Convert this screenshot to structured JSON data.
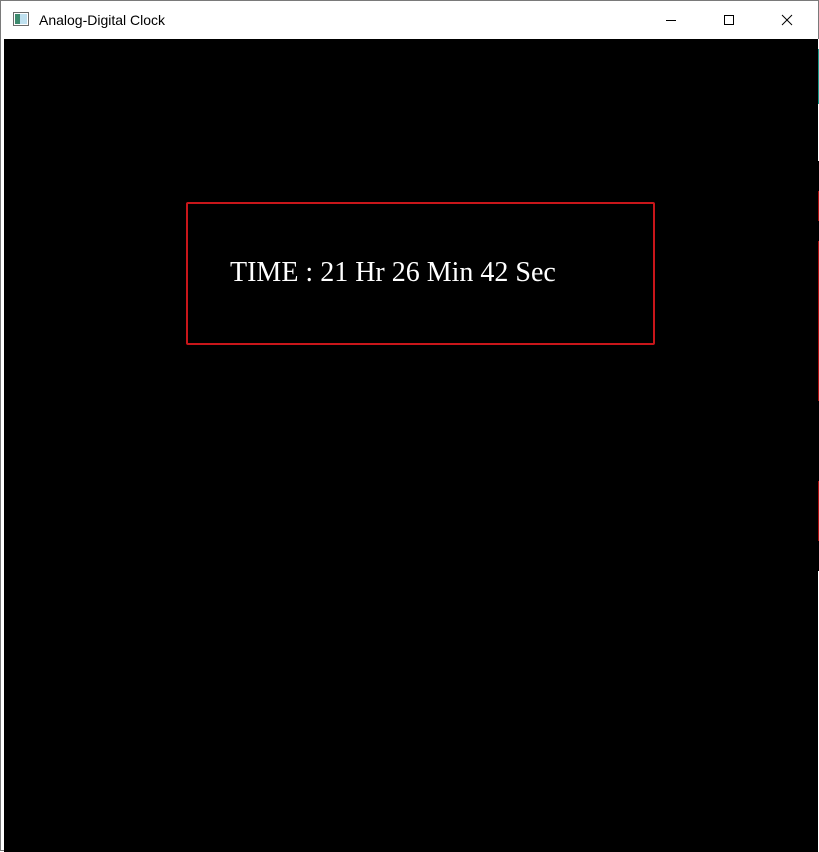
{
  "window": {
    "title": "Analog-Digital Clock",
    "icon": "app-window-icon",
    "controls": {
      "minimize_icon": "minimize-icon",
      "maximize_icon": "maximize-icon",
      "close_icon": "close-icon"
    }
  },
  "clock": {
    "time_text": "TIME : 21 Hr 26 Min 42 Sec",
    "hours": 21,
    "minutes": 26,
    "seconds": 42,
    "background_color": "#000000",
    "border_color": "#c8161a",
    "text_color": "#ffffff"
  }
}
